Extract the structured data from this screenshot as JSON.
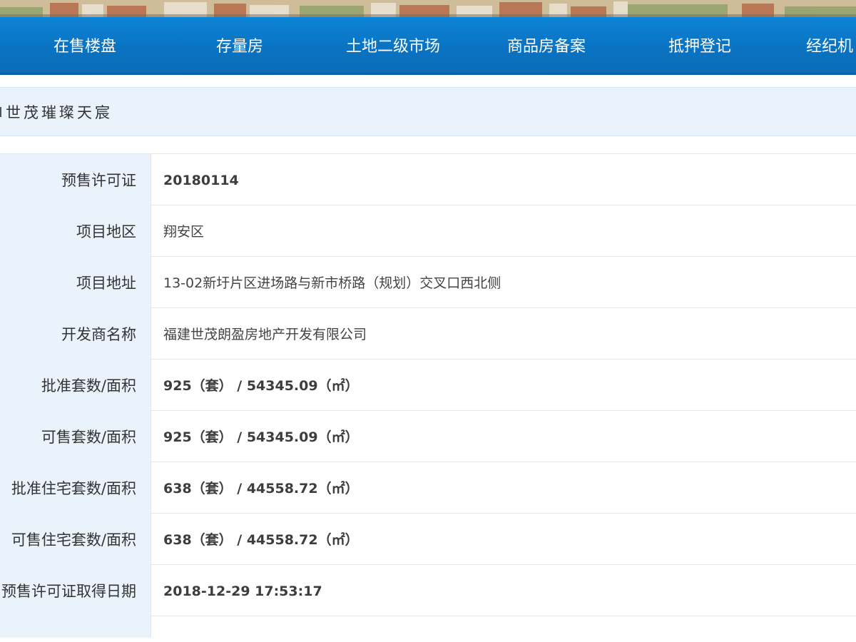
{
  "nav": {
    "items": [
      {
        "label": "在售楼盘"
      },
      {
        "label": "存量房"
      },
      {
        "label": "土地二级市场"
      },
      {
        "label": "商品房备案"
      },
      {
        "label": "抵押登记"
      },
      {
        "label": "经纪机"
      }
    ]
  },
  "project": {
    "title": "世茂璀璨天宸"
  },
  "table": {
    "rows": [
      {
        "label": "预售许可证",
        "value": "20180114"
      },
      {
        "label": "项目地区",
        "value": "翔安区"
      },
      {
        "label": "项目地址",
        "value": "13-02新圩片区进场路与新市桥路（规划）交叉口西北侧"
      },
      {
        "label": "开发商名称",
        "value": "福建世茂朗盈房地产开发有限公司"
      },
      {
        "label": "批准套数/面积",
        "value": "925（套） / 54345.09（㎡）"
      },
      {
        "label": "可售套数/面积",
        "value": "925（套） / 54345.09（㎡）"
      },
      {
        "label": "批准住宅套数/面积",
        "value": "638（套） / 44558.72（㎡）"
      },
      {
        "label": "可售住宅套数/面积",
        "value": "638（套） / 44558.72（㎡）"
      },
      {
        "label": "预售许可证取得日期",
        "value": "2018-12-29 17:53:17"
      }
    ]
  },
  "colors": {
    "nav_blue": "#0a73c2",
    "label_bg": "#eaf3fb",
    "border": "#e2e8ee"
  }
}
